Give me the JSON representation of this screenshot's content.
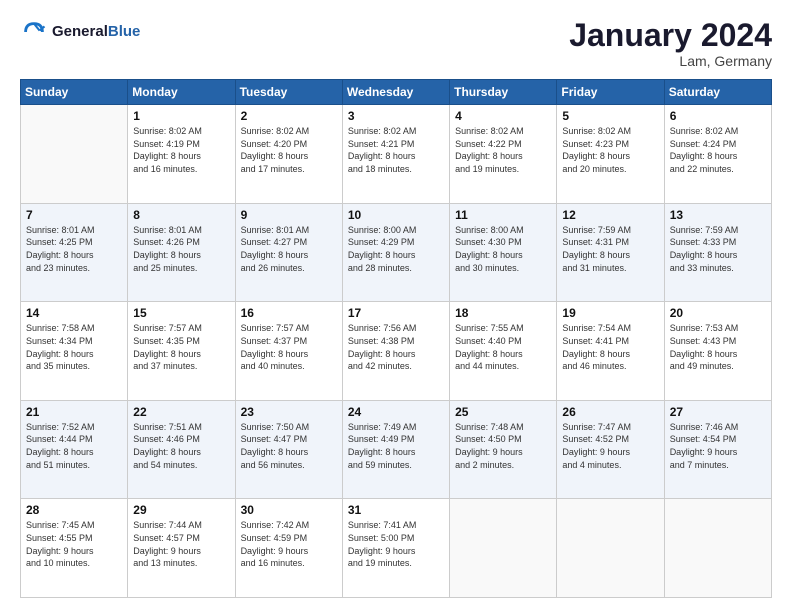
{
  "header": {
    "logo_line1": "General",
    "logo_line2": "Blue",
    "month_title": "January 2024",
    "location": "Lam, Germany"
  },
  "weekdays": [
    "Sunday",
    "Monday",
    "Tuesday",
    "Wednesday",
    "Thursday",
    "Friday",
    "Saturday"
  ],
  "weeks": [
    [
      {
        "day": "",
        "info": ""
      },
      {
        "day": "1",
        "info": "Sunrise: 8:02 AM\nSunset: 4:19 PM\nDaylight: 8 hours\nand 16 minutes."
      },
      {
        "day": "2",
        "info": "Sunrise: 8:02 AM\nSunset: 4:20 PM\nDaylight: 8 hours\nand 17 minutes."
      },
      {
        "day": "3",
        "info": "Sunrise: 8:02 AM\nSunset: 4:21 PM\nDaylight: 8 hours\nand 18 minutes."
      },
      {
        "day": "4",
        "info": "Sunrise: 8:02 AM\nSunset: 4:22 PM\nDaylight: 8 hours\nand 19 minutes."
      },
      {
        "day": "5",
        "info": "Sunrise: 8:02 AM\nSunset: 4:23 PM\nDaylight: 8 hours\nand 20 minutes."
      },
      {
        "day": "6",
        "info": "Sunrise: 8:02 AM\nSunset: 4:24 PM\nDaylight: 8 hours\nand 22 minutes."
      }
    ],
    [
      {
        "day": "7",
        "info": "Sunrise: 8:01 AM\nSunset: 4:25 PM\nDaylight: 8 hours\nand 23 minutes."
      },
      {
        "day": "8",
        "info": "Sunrise: 8:01 AM\nSunset: 4:26 PM\nDaylight: 8 hours\nand 25 minutes."
      },
      {
        "day": "9",
        "info": "Sunrise: 8:01 AM\nSunset: 4:27 PM\nDaylight: 8 hours\nand 26 minutes."
      },
      {
        "day": "10",
        "info": "Sunrise: 8:00 AM\nSunset: 4:29 PM\nDaylight: 8 hours\nand 28 minutes."
      },
      {
        "day": "11",
        "info": "Sunrise: 8:00 AM\nSunset: 4:30 PM\nDaylight: 8 hours\nand 30 minutes."
      },
      {
        "day": "12",
        "info": "Sunrise: 7:59 AM\nSunset: 4:31 PM\nDaylight: 8 hours\nand 31 minutes."
      },
      {
        "day": "13",
        "info": "Sunrise: 7:59 AM\nSunset: 4:33 PM\nDaylight: 8 hours\nand 33 minutes."
      }
    ],
    [
      {
        "day": "14",
        "info": "Sunrise: 7:58 AM\nSunset: 4:34 PM\nDaylight: 8 hours\nand 35 minutes."
      },
      {
        "day": "15",
        "info": "Sunrise: 7:57 AM\nSunset: 4:35 PM\nDaylight: 8 hours\nand 37 minutes."
      },
      {
        "day": "16",
        "info": "Sunrise: 7:57 AM\nSunset: 4:37 PM\nDaylight: 8 hours\nand 40 minutes."
      },
      {
        "day": "17",
        "info": "Sunrise: 7:56 AM\nSunset: 4:38 PM\nDaylight: 8 hours\nand 42 minutes."
      },
      {
        "day": "18",
        "info": "Sunrise: 7:55 AM\nSunset: 4:40 PM\nDaylight: 8 hours\nand 44 minutes."
      },
      {
        "day": "19",
        "info": "Sunrise: 7:54 AM\nSunset: 4:41 PM\nDaylight: 8 hours\nand 46 minutes."
      },
      {
        "day": "20",
        "info": "Sunrise: 7:53 AM\nSunset: 4:43 PM\nDaylight: 8 hours\nand 49 minutes."
      }
    ],
    [
      {
        "day": "21",
        "info": "Sunrise: 7:52 AM\nSunset: 4:44 PM\nDaylight: 8 hours\nand 51 minutes."
      },
      {
        "day": "22",
        "info": "Sunrise: 7:51 AM\nSunset: 4:46 PM\nDaylight: 8 hours\nand 54 minutes."
      },
      {
        "day": "23",
        "info": "Sunrise: 7:50 AM\nSunset: 4:47 PM\nDaylight: 8 hours\nand 56 minutes."
      },
      {
        "day": "24",
        "info": "Sunrise: 7:49 AM\nSunset: 4:49 PM\nDaylight: 8 hours\nand 59 minutes."
      },
      {
        "day": "25",
        "info": "Sunrise: 7:48 AM\nSunset: 4:50 PM\nDaylight: 9 hours\nand 2 minutes."
      },
      {
        "day": "26",
        "info": "Sunrise: 7:47 AM\nSunset: 4:52 PM\nDaylight: 9 hours\nand 4 minutes."
      },
      {
        "day": "27",
        "info": "Sunrise: 7:46 AM\nSunset: 4:54 PM\nDaylight: 9 hours\nand 7 minutes."
      }
    ],
    [
      {
        "day": "28",
        "info": "Sunrise: 7:45 AM\nSunset: 4:55 PM\nDaylight: 9 hours\nand 10 minutes."
      },
      {
        "day": "29",
        "info": "Sunrise: 7:44 AM\nSunset: 4:57 PM\nDaylight: 9 hours\nand 13 minutes."
      },
      {
        "day": "30",
        "info": "Sunrise: 7:42 AM\nSunset: 4:59 PM\nDaylight: 9 hours\nand 16 minutes."
      },
      {
        "day": "31",
        "info": "Sunrise: 7:41 AM\nSunset: 5:00 PM\nDaylight: 9 hours\nand 19 minutes."
      },
      {
        "day": "",
        "info": ""
      },
      {
        "day": "",
        "info": ""
      },
      {
        "day": "",
        "info": ""
      }
    ]
  ]
}
